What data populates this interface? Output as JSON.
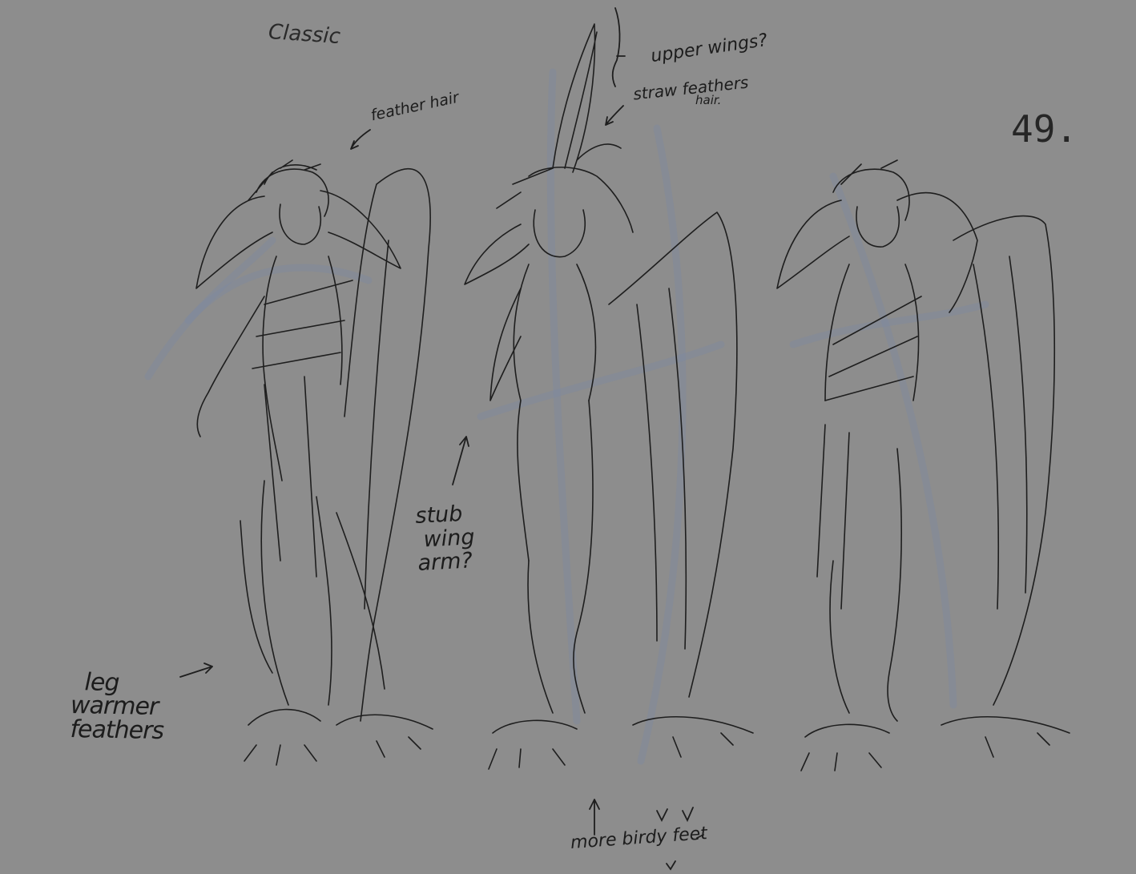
{
  "annotations": {
    "classic": "Classic",
    "feather_hair": "feather hair",
    "upper_wings": "upper wings?",
    "straw_feathers": "straw feathers",
    "hair": "hair.",
    "page_number": "49.",
    "stub_wing_arm": "stub\n wing\narm?",
    "leg_warmer_feathers": "  leg\nwarmer\nfeathers",
    "more_birdy_feet": "more birdy feet"
  },
  "colors": {
    "background": "#8d8d8d",
    "pencil": "#1e1e1e",
    "underdrawing": "#7d8aa0"
  }
}
